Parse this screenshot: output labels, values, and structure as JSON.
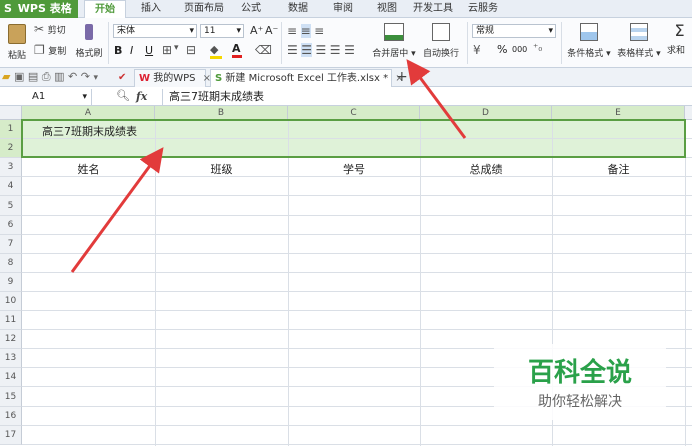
{
  "app": {
    "name": "WPS 表格",
    "dropdown": "▾"
  },
  "menu": {
    "tabs": [
      "开始",
      "插入",
      "页面布局",
      "公式",
      "数据",
      "审阅",
      "视图",
      "开发工具",
      "云服务"
    ],
    "active": "开始"
  },
  "ribbon": {
    "paste": "粘贴",
    "cut": "剪切",
    "copy": "复制",
    "format_painter": "格式刷",
    "font_name": "宋体",
    "font_size": "11",
    "bold": "B",
    "italic": "I",
    "underline": "U",
    "grow_font": "A⁺",
    "shrink_font": "A⁻",
    "font_color_glyph": "A",
    "merge_center": "合并居中",
    "wrap_text": "自动换行",
    "number_format": "常规",
    "percent": "%",
    "thousands": "000",
    "conditional_format": "条件格式",
    "table_style": "表格样式",
    "find": "求和"
  },
  "doc_tabs": {
    "home": "我的WPS",
    "file": "新建 Microsoft Excel 工作表.xlsx *",
    "close": "×",
    "add": "+"
  },
  "formula_bar": {
    "name_box": "A1",
    "fx": "fx",
    "zoom_icon": "zoom-icon",
    "content": "高三7班期末成绩表"
  },
  "sheet": {
    "columns": [
      "A",
      "B",
      "C",
      "D",
      "E"
    ],
    "rows": [
      "1",
      "2",
      "3",
      "4",
      "5",
      "6",
      "7",
      "8",
      "9",
      "10",
      "11",
      "12",
      "13",
      "14",
      "15",
      "16",
      "17"
    ],
    "title": "高三7班期末成绩表",
    "headers": [
      "姓名",
      "班级",
      "学号",
      "总成绩",
      "备注"
    ],
    "selection_color": "#dff2d8",
    "selection_border": "#5a9e43"
  },
  "watermark": {
    "title": "百科全说",
    "subtitle": "助你轻松解决"
  },
  "colors": {
    "accent": "#4f9a3a",
    "arrow": "#e23b3b"
  }
}
